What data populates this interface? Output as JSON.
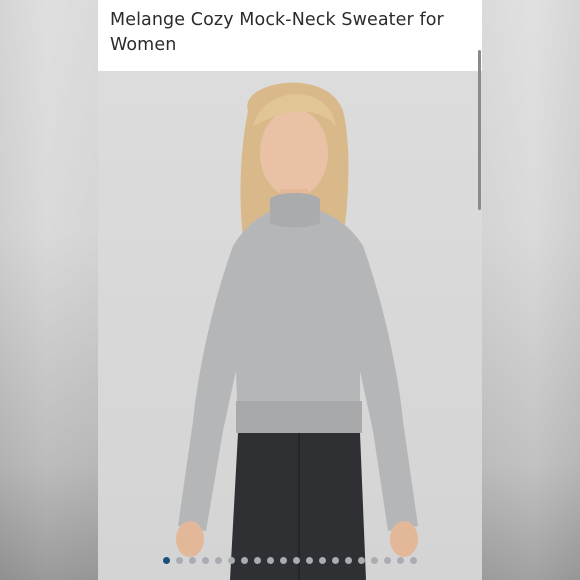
{
  "product": {
    "title": "Melange Cozy Mock-Neck Sweater for Women"
  },
  "carousel": {
    "image_count": 20,
    "active_index": 0,
    "active_color": "#1c4e7a",
    "inactive_color": "#a9adb3"
  },
  "icons": {
    "carousel_dot": "dot-icon"
  }
}
